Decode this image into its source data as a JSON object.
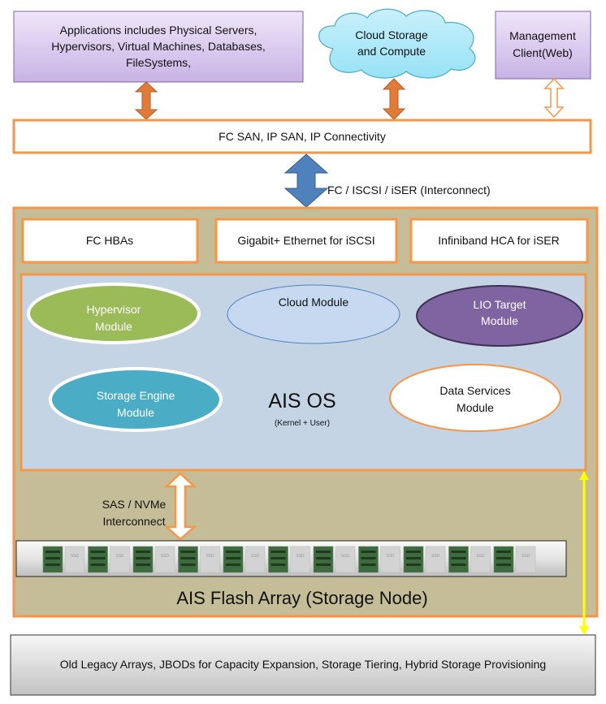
{
  "top": {
    "applications": [
      "Applications includes Physical Servers,",
      "Hypervisors, Virtual Machines, Databases,",
      "FileSystems,"
    ],
    "cloud": [
      "Cloud Storage",
      "and Compute"
    ],
    "management": [
      "Management",
      "Client(Web)"
    ]
  },
  "san_bar": "FC SAN, IP SAN, IP Connectivity",
  "interconnect_label": "FC  / ISCSI / iSER (Interconnect)",
  "adapters": [
    "FC HBAs",
    "Gigabit+ Ethernet for iSCSI",
    "Infiniband HCA for iSER"
  ],
  "modules": {
    "hypervisor": [
      "Hypervisor",
      "Module"
    ],
    "cloud": "Cloud Module",
    "lio": [
      "LIO Target",
      "Module"
    ],
    "storage_engine": [
      "Storage Engine",
      "Module"
    ],
    "data_services": [
      "Data Services",
      "Module"
    ]
  },
  "os": {
    "title": "AIS OS",
    "subtitle": "(Kernel + User)"
  },
  "sas_label": [
    "SAS / NVMe",
    "Interconnect"
  ],
  "drive_label": "SSD",
  "drive_pairs": 11,
  "flash_array_label": "AIS Flash Array (Storage Node)",
  "legacy": "Old Legacy Arrays, JBODs for Capacity Expansion, Storage Tiering, Hybrid Storage Provisioning",
  "colors": {
    "orange": "#f79646",
    "tan": "#c4bd97",
    "blue_panel": "#c5d4e4",
    "purple": "#8064a2",
    "green": "#9bbb59",
    "teal": "#4bacc6",
    "yellow": "#ffff00",
    "blue_arrow": "#4f81bd"
  }
}
